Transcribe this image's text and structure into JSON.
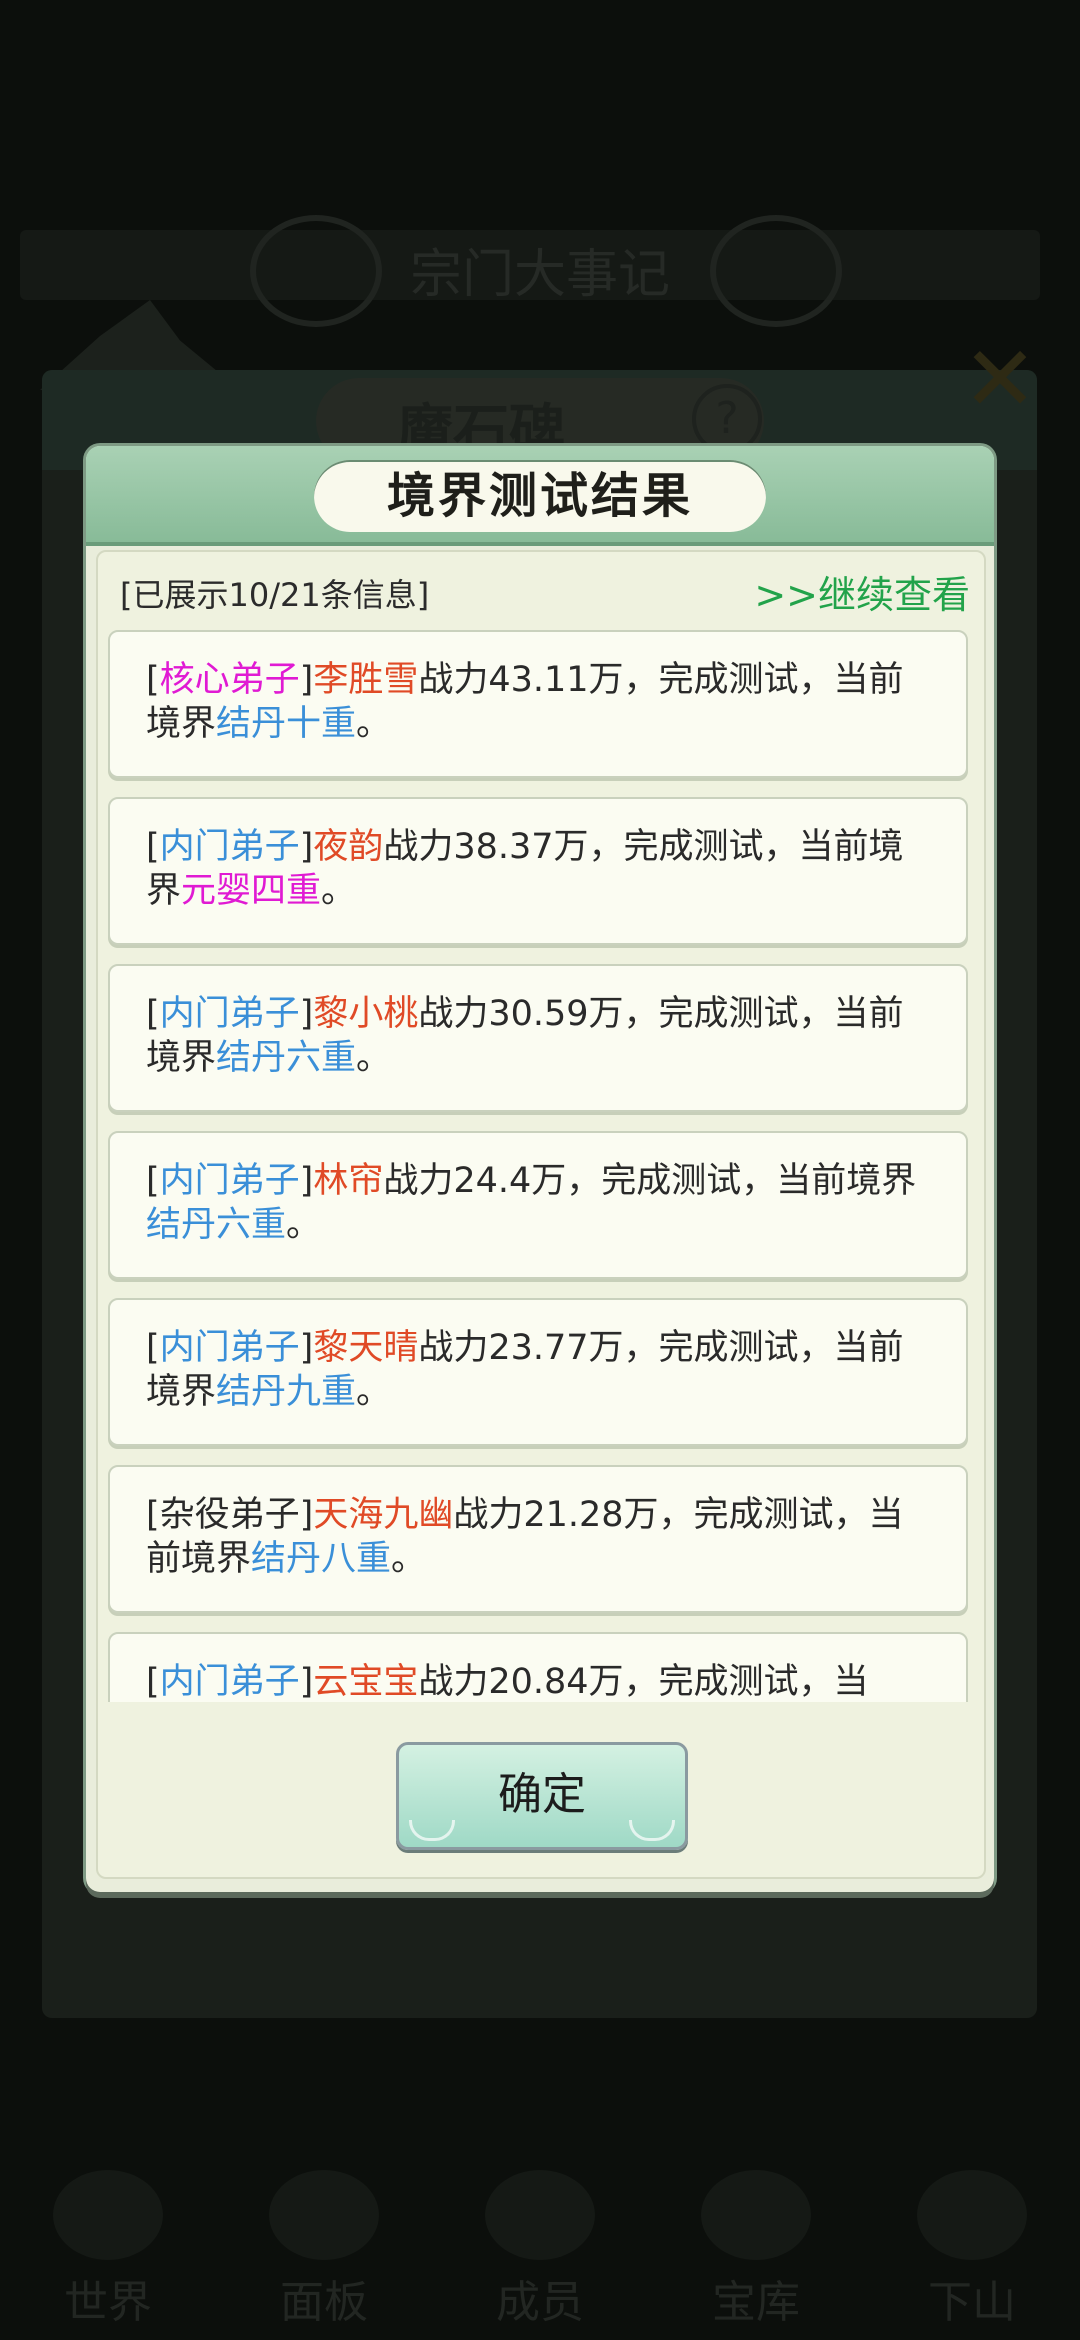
{
  "background": {
    "top_title": "宗门大事记",
    "panel_title": "魔石碑",
    "help_icon": "?",
    "close_icon": "✕",
    "nav": [
      "世界",
      "面板",
      "成员",
      "宝库",
      "下山"
    ]
  },
  "dialog": {
    "title": "境界测试结果",
    "info_count": "[已展示10/21条信息]",
    "continue_label": ">>继续查看",
    "confirm_label": "确定"
  },
  "records": [
    {
      "rank": "核心弟子",
      "rank_type": "core",
      "name": "李胜雪",
      "power": "战力43.11万，完成测试，当前境界",
      "realm": "结丹十重",
      "realm_type": "blue"
    },
    {
      "rank": "内门弟子",
      "rank_type": "inner",
      "name": "夜韵",
      "power": "战力38.37万，完成测试，当前境界",
      "realm": "元婴四重",
      "realm_type": "pink"
    },
    {
      "rank": "内门弟子",
      "rank_type": "inner",
      "name": "黎小桃",
      "power": "战力30.59万，完成测试，当前境界",
      "realm": "结丹六重",
      "realm_type": "blue"
    },
    {
      "rank": "内门弟子",
      "rank_type": "inner",
      "name": "林帘",
      "power": "战力24.4万，完成测试，当前境界",
      "realm": "结丹六重",
      "realm_type": "blue"
    },
    {
      "rank": "内门弟子",
      "rank_type": "inner",
      "name": "黎天晴",
      "power": "战力23.77万，完成测试，当前境界",
      "realm": "结丹九重",
      "realm_type": "blue"
    },
    {
      "rank": "杂役弟子",
      "rank_type": "misc",
      "name": "天海九幽",
      "power": "战力21.28万，完成测试，当前境界",
      "realm": "结丹八重",
      "realm_type": "blue"
    },
    {
      "rank": "内门弟子",
      "rank_type": "inner",
      "name": "云宝宝",
      "power": "战力20.84万，完成测试，当",
      "realm": "",
      "realm_type": "blue"
    }
  ]
}
